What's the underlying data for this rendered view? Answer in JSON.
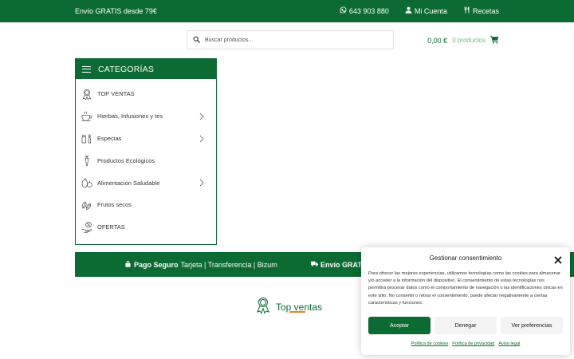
{
  "topbar": {
    "promo": "Envío GRATIS desde 79€",
    "phone": "643 903 880",
    "account": "Mi Cuenta",
    "recipes": "Recetas"
  },
  "search": {
    "placeholder": "Buscar productos..."
  },
  "cart": {
    "amount": "0,00 €",
    "count": "0 productos"
  },
  "categories": {
    "title": "CATEGORÍAS",
    "items": [
      {
        "label": "TOP VENTAS",
        "icon": "award-ribbon-icon",
        "has_submenu": false
      },
      {
        "label": "Hierbas, Infusiones y tes",
        "icon": "teacup-icon",
        "has_submenu": true
      },
      {
        "label": "Especias",
        "icon": "spice-jars-icon",
        "has_submenu": true
      },
      {
        "label": "Productos Ecológicos",
        "icon": "carrot-icon",
        "has_submenu": false
      },
      {
        "label": "Alimentación Saludable",
        "icon": "fruit-icon",
        "has_submenu": true
      },
      {
        "label": "Frutos secos",
        "icon": "nuts-icon",
        "has_submenu": false
      },
      {
        "label": "OFERTAS",
        "icon": "discount-hand-icon",
        "has_submenu": false
      }
    ]
  },
  "paybar": {
    "pay_strong": "Pago Seguro",
    "pay_methods": "Tarjeta | Transferencia | Bizum",
    "ship_strong": "Envío GRATI"
  },
  "top_ventas": {
    "title": "Top ventas"
  },
  "consent": {
    "title": "Gestionar consentimiento",
    "description": "Para ofrecer las mejores experiencias, utilizamos tecnologías como las cookies para almacenar y/o acceder a la información del dispositivo. El consentimiento de estas tecnologías nos permitirá procesar datos como el comportamiento de navegación o las identificaciones únicas en este sitio. No consentir o retirar el consentimiento, puede afectar negativamente a ciertas características y funciones.",
    "accept": "Aceptar",
    "deny": "Denegar",
    "preferences": "Ver preferencias",
    "links": [
      "Política de cookies",
      "Política de privacidad",
      "Aviso legal"
    ]
  },
  "colors": {
    "brand_green": "#0b6b32",
    "accent_orange": "#e08a1e",
    "light_green": "#6cbc8a"
  }
}
